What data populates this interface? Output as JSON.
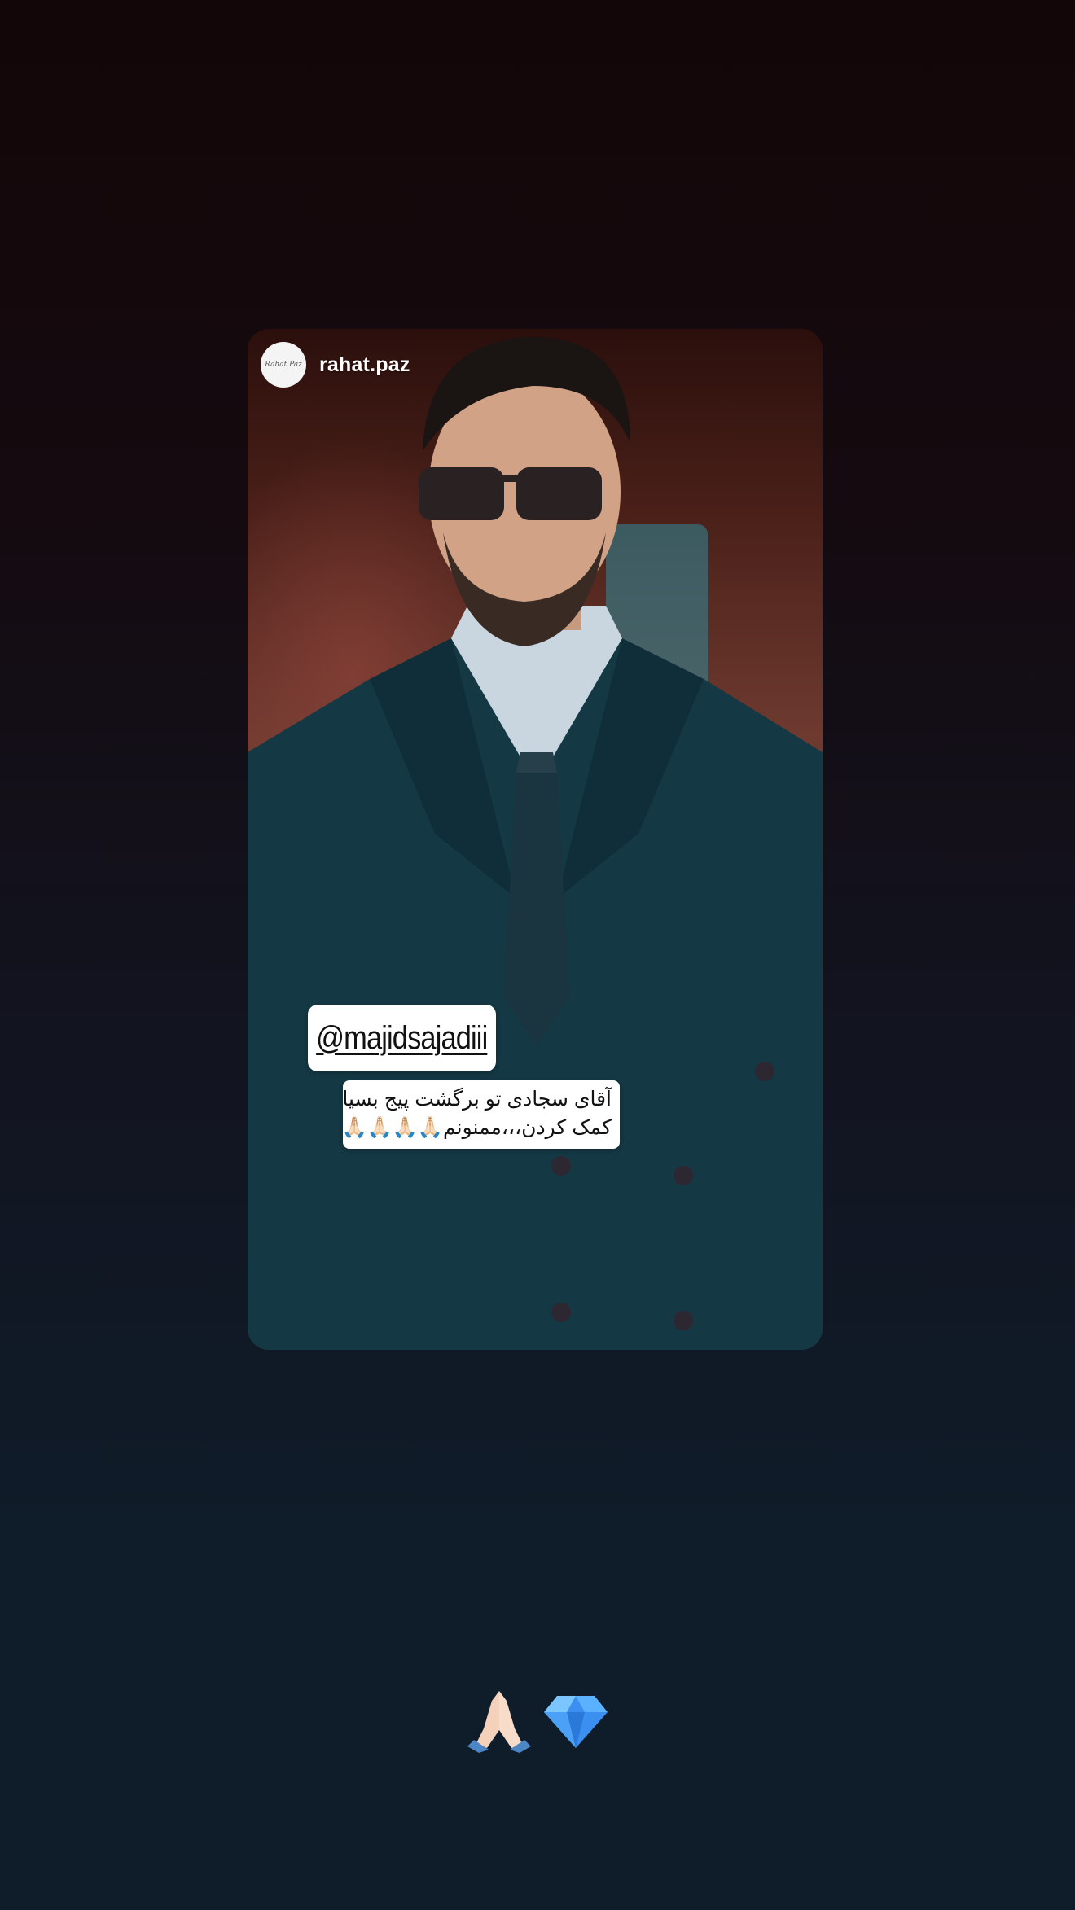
{
  "story": {
    "username": "rahat.paz",
    "avatar_text": "Rahat.Paz",
    "mention_sticker": "@majidsajadiii",
    "caption_lines": [
      "آقای سجادی تو برگشت پیج بسیار",
      "کمک کردن،،،ممنونم🙏🏻🙏🏻🙏🏻🙏🏻"
    ]
  },
  "reactions": [
    {
      "icon": "folded-hands-icon",
      "symbol": "🙏🏻"
    },
    {
      "icon": "gem-stone-icon",
      "symbol": "💎"
    }
  ]
}
